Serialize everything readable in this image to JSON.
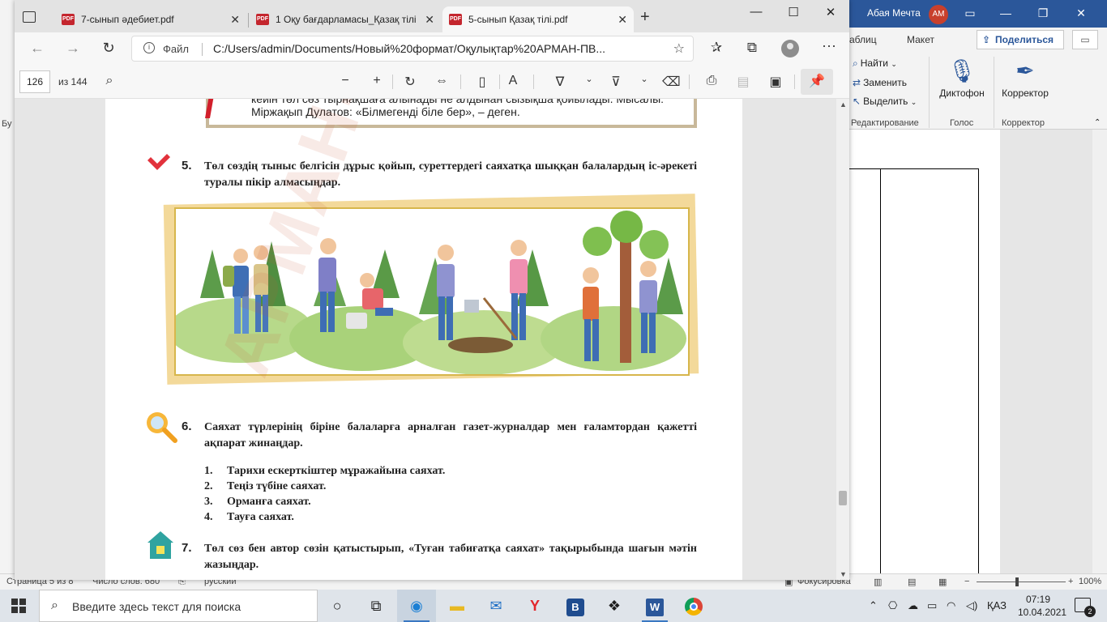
{
  "word": {
    "user_name": "Абая Мечта",
    "user_initials": "АМ",
    "ribbon_tabs": [
      "аблиц",
      "Макет"
    ],
    "share_label": "Поделиться",
    "find_label": "Найти",
    "replace_label": "Заменить",
    "select_label": "Выделить",
    "editing_group": "Редактирование",
    "dictate_label": "Диктофон",
    "voice_group": "Голос",
    "editor_label": "Корректор",
    "editor_group": "Корректор",
    "left_strip_text": "Бу",
    "status": {
      "page": "Страница 5 из 8",
      "words": "Число слов: 680",
      "language": "русский",
      "focus": "Фокусировка",
      "zoom": "100%"
    }
  },
  "browser": {
    "tabs": [
      {
        "title": "7-сынып әдебиет.pdf",
        "active": false
      },
      {
        "title": "1 Оқу бағдарламасы_Қазақ тілі",
        "active": false
      },
      {
        "title": "5-сынып Қазақ тілі.pdf",
        "active": true
      }
    ],
    "address": {
      "scheme_label": "Файл",
      "url": "C:/Users/admin/Documents/Новый%20формат/Оқулықтар%20АРМАН-ПВ..."
    },
    "pdf_toolbar": {
      "page_current": "126",
      "page_total": "из 144"
    }
  },
  "page": {
    "quote_line1": "кейін төл сөз тырнақшаға алынады не алдынан сызықша қойылады. Мысалы:",
    "quote_line2": "Міржақып Дулатов: «Білмегенді біле бер», – деген.",
    "task5_num": "5.",
    "task5_text": "Төл сөздің тыныс белгісін дұрыс қойып, суреттердегі саяхатқа шыққан балалардың іс-әрекеті туралы пікір алмасыңдар.",
    "task6_num": "6.",
    "task6_text": "Саяхат түрлерінің біріне балаларға арналған газет-журналдар мен ғаламтордан қажетті ақпарат жинаңдар.",
    "list": [
      {
        "n": "1.",
        "text": "Тарихи ескерткіштер мұражайына саяхат."
      },
      {
        "n": "2.",
        "text": "Теңіз түбіне саяхат."
      },
      {
        "n": "3.",
        "text": "Орманға саяхат."
      },
      {
        "n": "4.",
        "text": "Тауға саяхат."
      }
    ],
    "task7_num": "7.",
    "task7_text": "Төл сөз бен автор сөзін қатыстырып, «Туған табиғатқа саяхат» тақырыбында шағын мәтін жазыңдар.",
    "watermark": "АРМАН-ПВ баспасы"
  },
  "taskbar": {
    "search_placeholder": "Введите здесь текст для поиска",
    "lang": "ҚАЗ",
    "time": "07:19",
    "date": "10.04.2021",
    "notifications": "2"
  }
}
